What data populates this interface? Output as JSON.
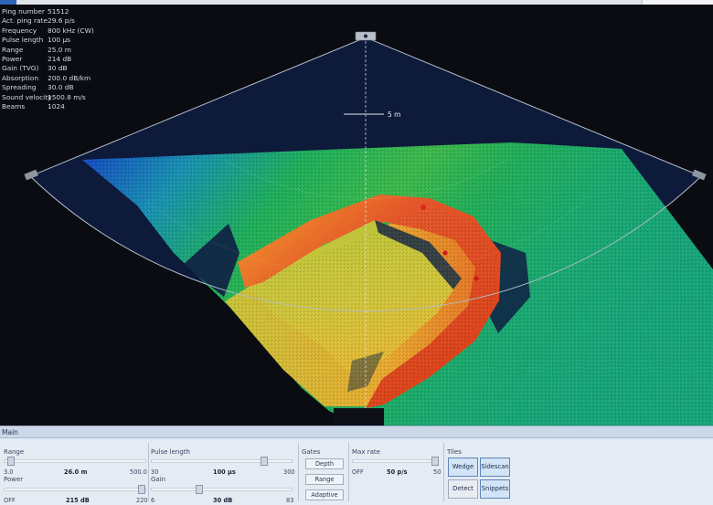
{
  "ping_info": [
    {
      "label": "Ping number",
      "value": "51512"
    },
    {
      "label": "Act. ping rate",
      "value": "29.6 p/s"
    },
    {
      "label": "Frequency",
      "value": "800 kHz (CW)"
    },
    {
      "label": "Pulse length",
      "value": "100 μs"
    },
    {
      "label": "Range",
      "value": "25.0 m"
    },
    {
      "label": "Power",
      "value": "214 dB"
    },
    {
      "label": "Gain (TVG)",
      "value": "30 dB"
    },
    {
      "label": "Absorption",
      "value": "200.0 dB/km"
    },
    {
      "label": "Spreading",
      "value": "30.0 dB"
    },
    {
      "label": "Sound velocity",
      "value": "1500.8 m/s"
    },
    {
      "label": "Beams",
      "value": "1024"
    }
  ],
  "sonar": {
    "range_scale_label": "5 m",
    "colors": {
      "bg": "#0a0c12",
      "deep": "#1244b8",
      "mid": "#1fb050",
      "high": "#e2d33a",
      "top": "#d63a14"
    }
  },
  "panel": {
    "title": "Main",
    "range": {
      "title": "Range",
      "min": "3.0",
      "value": "26.0 m",
      "max": "500.0",
      "level": 0.05
    },
    "power": {
      "title": "Power",
      "min": "OFF",
      "value": "215 dB",
      "max": "220",
      "level": 0.97
    },
    "pulse_length": {
      "title": "Pulse length",
      "min": "30",
      "value": "100 μs",
      "max": "300",
      "level": 0.8
    },
    "gain": {
      "title": "Gain",
      "min": "6",
      "value": "30 dB",
      "max": "83",
      "level": 0.34
    },
    "gates": {
      "title": "Gates",
      "buttons": [
        "Depth",
        "Range",
        "Adaptive"
      ]
    },
    "max_rate": {
      "title": "Max rate",
      "min": "OFF",
      "value": "50 p/s",
      "max": "50",
      "level": 0.96
    },
    "tiles": {
      "title": "Tiles",
      "wedge": "Wedge",
      "sidescan": "Sidescan",
      "detect": "Detect",
      "snippets": "Snippets"
    }
  }
}
